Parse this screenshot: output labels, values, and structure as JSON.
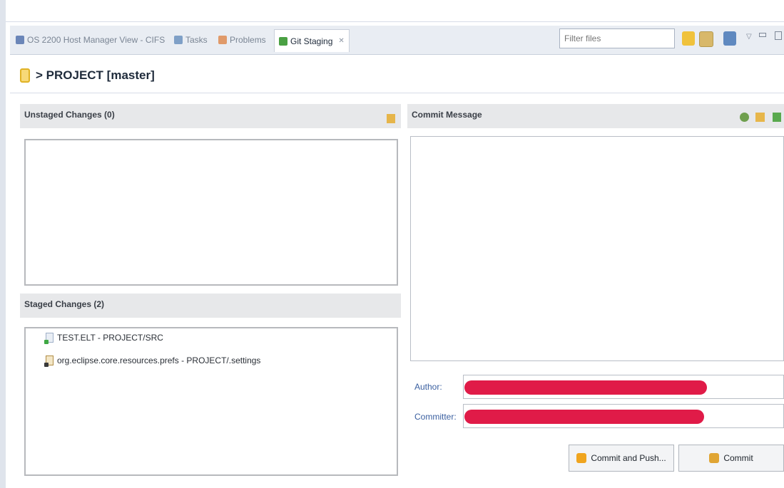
{
  "tabs": [
    {
      "label": "OS 2200 Host Manager View - CIFS",
      "icon": "host-manager-icon",
      "color": "#6b86b8"
    },
    {
      "label": "Tasks",
      "icon": "tasks-icon",
      "color": "#7fa0c7"
    },
    {
      "label": "Problems",
      "icon": "problems-icon",
      "color": "#e09a6a"
    },
    {
      "label": "Git Staging",
      "icon": "git-staging-icon",
      "color": "#4aa043",
      "close": "✕"
    }
  ],
  "toolbar": {
    "filter_placeholder": "Filter files"
  },
  "repo": {
    "title": "> PROJECT [master]"
  },
  "unstaged": {
    "header": "Unstaged Changes (0)"
  },
  "staged": {
    "header": "Staged Changes (2)",
    "items": [
      {
        "label": "TEST.ELT - PROJECT/SRC",
        "icon": "file-added-icon"
      },
      {
        "label": "org.eclipse.core.resources.prefs - PROJECT/.settings",
        "icon": "file-modified-icon"
      }
    ]
  },
  "commit": {
    "header": "Commit Message",
    "message": "",
    "author_label": "Author:",
    "committer_label": "Committer:",
    "commit_push_label": "Commit and Push...",
    "commit_label": "Commit"
  },
  "colors": {
    "redaction": "#e01b48",
    "accent": "#3a5fa0"
  }
}
